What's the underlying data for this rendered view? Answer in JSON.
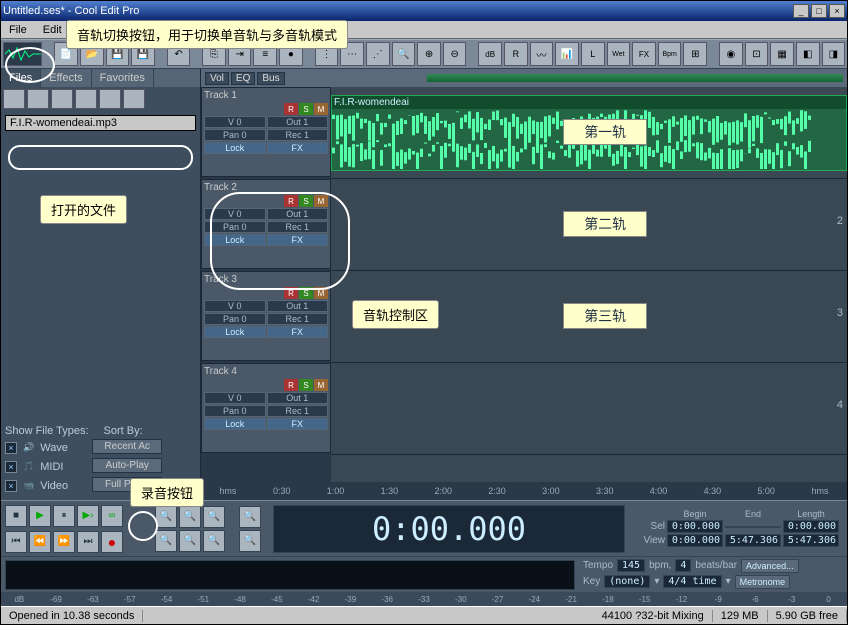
{
  "title": "Untitled.ses* - Cool Edit Pro",
  "menu": [
    "File",
    "Edit"
  ],
  "window_buttons": [
    "_",
    "□",
    "×"
  ],
  "tabs": [
    "Files",
    "Effects",
    "Favorites"
  ],
  "file_item": "F.I.R-womendeai.mp3",
  "file_types_header": "Show File Types:",
  "sort_header": "Sort By:",
  "file_types": [
    "Wave",
    "MIDI",
    "Video"
  ],
  "sort_buttons": [
    "Recent Ac",
    "Auto-Play",
    "Full Paths"
  ],
  "vol_eq": [
    "Vol",
    "EQ",
    "Bus"
  ],
  "tracks": [
    {
      "title": "Track 1",
      "v": "V 0",
      "out": "Out 1",
      "pan": "Pan 0",
      "rec": "Rec 1",
      "lock": "Lock",
      "fx": "FX",
      "lane_label": "第一轨",
      "clip": "F.I.R-womendeai"
    },
    {
      "title": "Track 2",
      "v": "V 0",
      "out": "Out 1",
      "pan": "Pan 0",
      "rec": "Rec 1",
      "lock": "Lock",
      "fx": "FX",
      "lane_label": "第二轨"
    },
    {
      "title": "Track 3",
      "v": "V 0",
      "out": "Out 1",
      "pan": "Pan 0",
      "rec": "Rec 1",
      "lock": "Lock",
      "fx": "FX",
      "lane_label": "第三轨"
    },
    {
      "title": "Track 4",
      "v": "V 0",
      "out": "Out 1",
      "pan": "Pan 0",
      "rec": "Rec 1",
      "lock": "Lock",
      "fx": "FX",
      "lane_label": ""
    }
  ],
  "rsm": [
    "R",
    "S",
    "M"
  ],
  "ruler": [
    "hms",
    "0:30",
    "1:00",
    "1:30",
    "2:00",
    "2:30",
    "3:00",
    "3:30",
    "4:00",
    "4:30",
    "5:00",
    "hms"
  ],
  "time_display": "0:00.000",
  "sel_headers": [
    "Begin",
    "End",
    "Length"
  ],
  "sel": {
    "label": "Sel",
    "begin": "0:00.000",
    "end": "",
    "length": "0:00.000"
  },
  "view": {
    "label": "View",
    "begin": "0:00.000",
    "end": "5:47.306",
    "length": "5:47.306"
  },
  "tempo": {
    "label": "Tempo",
    "bpm_val": "145",
    "bpm": "bpm,",
    "beats_val": "4",
    "beats": "beats/bar",
    "adv": "Advanced..."
  },
  "key": {
    "label": "Key",
    "val": "(none)",
    "sig": "4/4 time",
    "metro": "Metronome"
  },
  "db": [
    "dB",
    "-69",
    "-63",
    "-57",
    "-54",
    "-51",
    "-48",
    "-45",
    "-42",
    "-39",
    "-36",
    "-33",
    "-30",
    "-27",
    "-24",
    "-21",
    "-18",
    "-15",
    "-12",
    "-9",
    "-6",
    "-3",
    "0"
  ],
  "status": {
    "opened": "Opened in 10.38 seconds",
    "format": "44100 ?32-bit Mixing",
    "mem": "129 MB",
    "disk": "5.90 GB free"
  },
  "callouts": {
    "track_toggle": "音轨切换按钮，用于切换单音轨与多音轨模式",
    "open_file": "打开的文件",
    "track_ctrl": "音轨控制区",
    "rec_btn": "录音按钮"
  },
  "toolbar_labels": [
    "dB",
    "R",
    "L",
    "Wet",
    "FX",
    "Bpm"
  ]
}
